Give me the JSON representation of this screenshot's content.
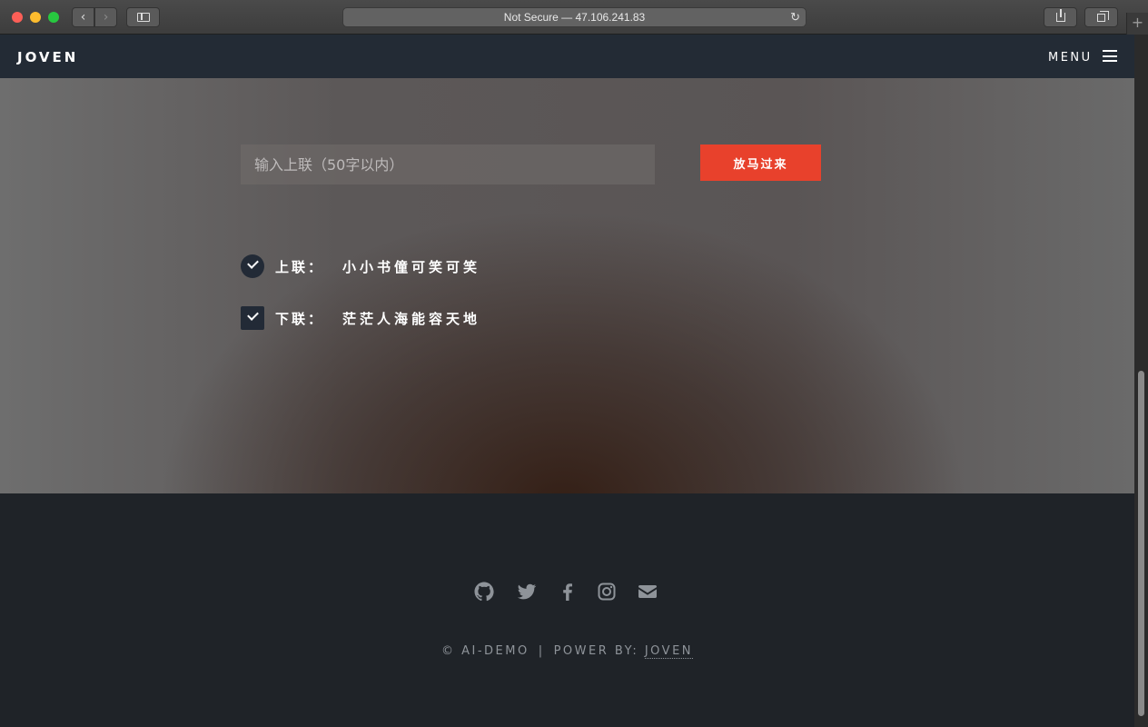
{
  "browser": {
    "url_text": "Not Secure — 47.106.241.83",
    "back_glyph": "‹",
    "forward_glyph": "›",
    "reload_glyph": "↻",
    "newtab_glyph": "+"
  },
  "nav": {
    "brand": "JOVEN",
    "menu_label": "MENU"
  },
  "form": {
    "placeholder": "输入上联（50字以内）",
    "submit_label": "放马过来",
    "accent_color": "#e8412c"
  },
  "couplet": {
    "upper_label": "上联：",
    "upper_text": "小小书僮可笑可笑",
    "lower_label": "下联：",
    "lower_text": "茫茫人海能容天地"
  },
  "footer": {
    "social_icons": [
      "github-icon",
      "twitter-icon",
      "facebook-icon",
      "instagram-icon",
      "envelope-icon"
    ],
    "copyright": "© AI-DEMO",
    "separator": "|",
    "power_by": "POWER BY:",
    "author": "JOVEN"
  }
}
